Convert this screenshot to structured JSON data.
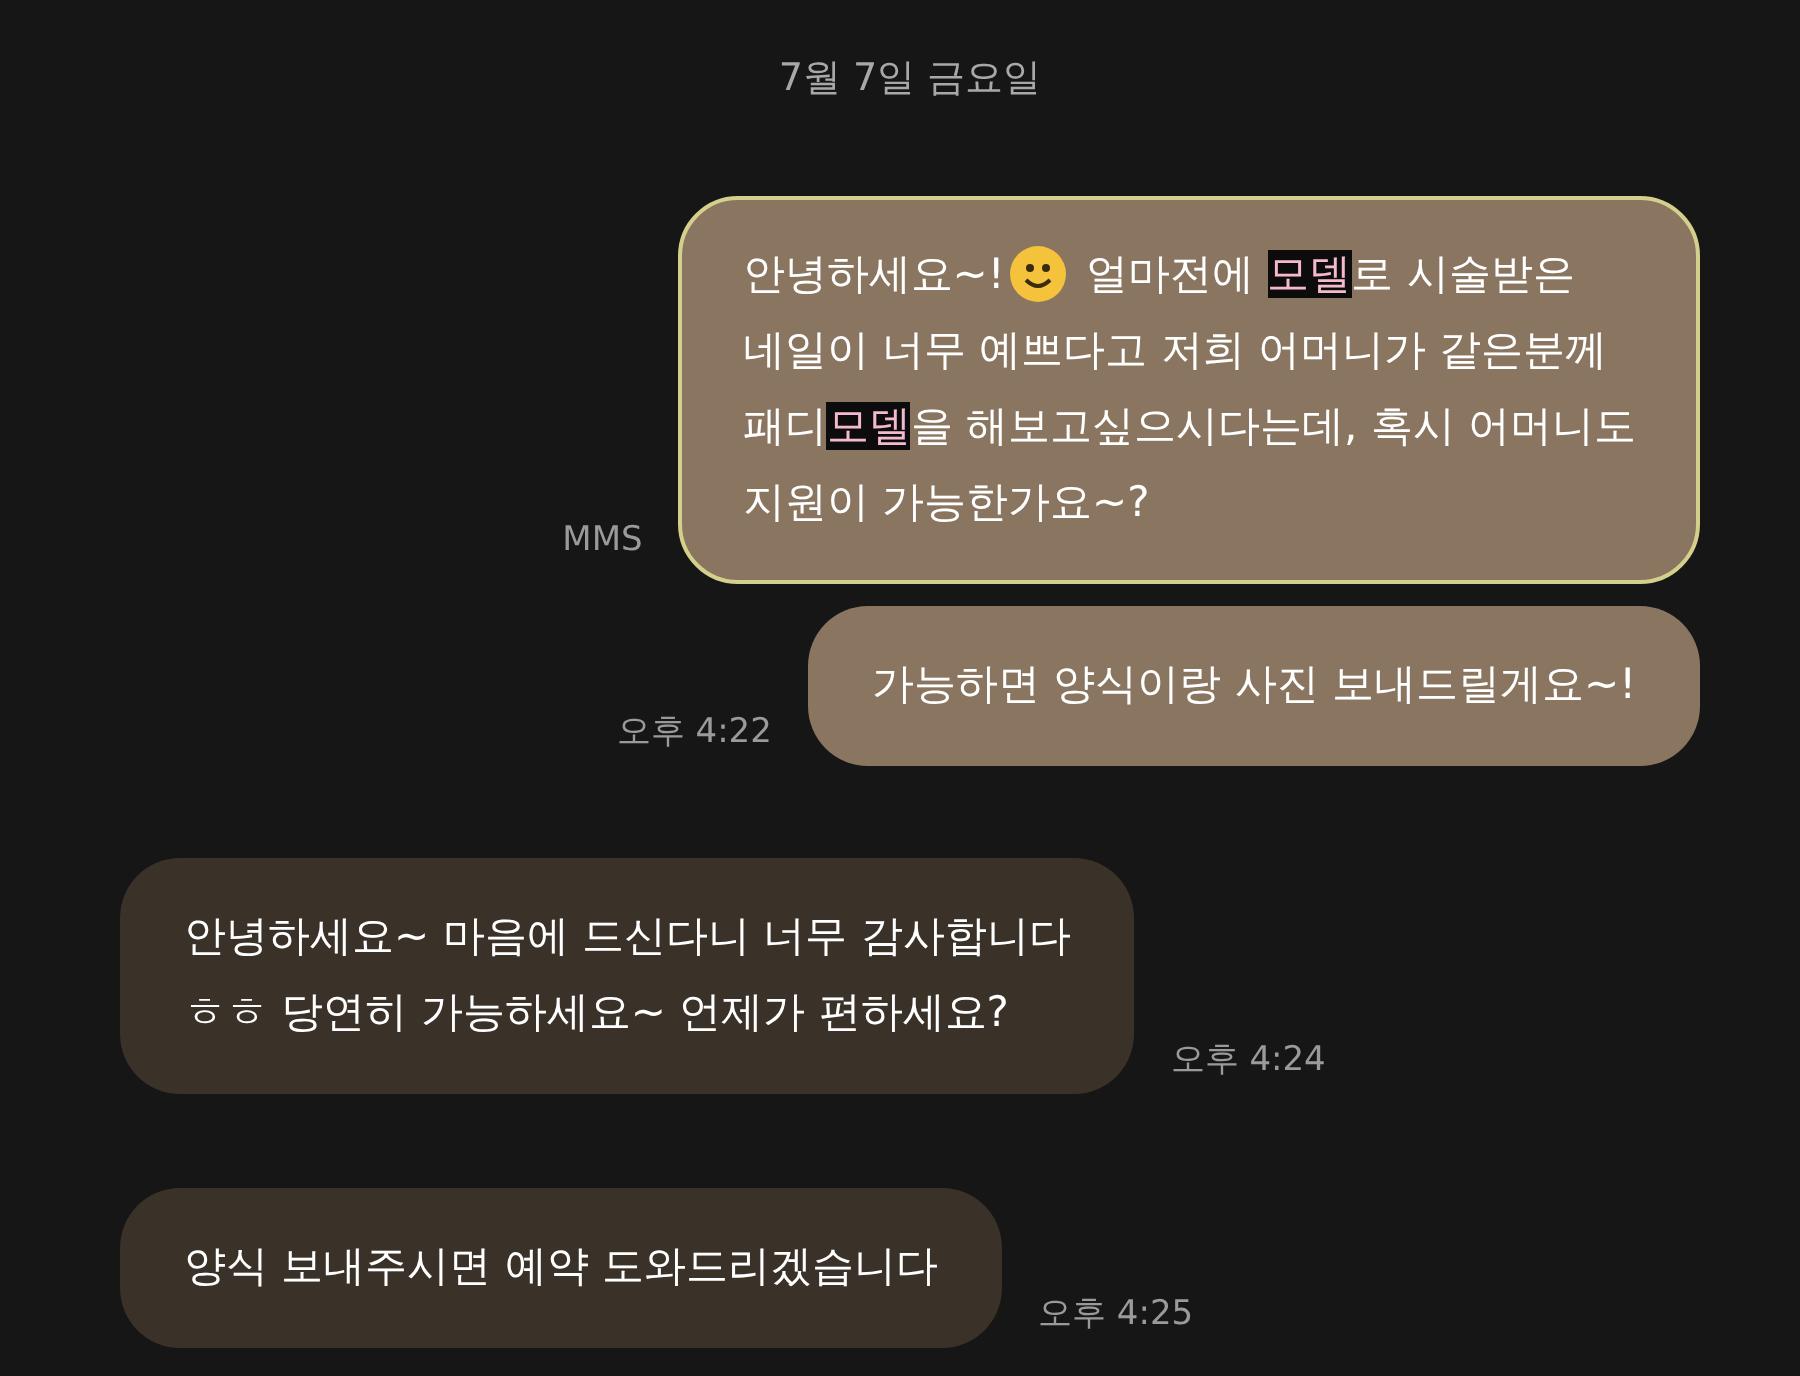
{
  "date_divider": "7월 7일 금요일",
  "messages": [
    {
      "kind": "sent",
      "selected": true,
      "label": "MMS",
      "lines": [
        [
          {
            "kind": "text",
            "text": "안녕하세요~!",
            "highlight": false
          },
          {
            "kind": "emoji"
          },
          {
            "kind": "text",
            "text": " 얼마전에 ",
            "highlight": false
          },
          {
            "kind": "text",
            "text": "모델",
            "highlight": true
          },
          {
            "kind": "text",
            "text": "로 시술받은",
            "highlight": false
          }
        ],
        [
          {
            "kind": "text",
            "text": "네일이 너무 예쁘다고 저희 어머니가 같은분께",
            "highlight": false
          }
        ],
        [
          {
            "kind": "text",
            "text": "패디",
            "highlight": false
          },
          {
            "kind": "text",
            "text": "모델",
            "highlight": true
          },
          {
            "kind": "text",
            "text": "을 해보고싶으시다는데, 혹시 어머니도",
            "highlight": false
          }
        ],
        [
          {
            "kind": "text",
            "text": "지원이 가능한가요~?",
            "highlight": false
          }
        ]
      ]
    },
    {
      "kind": "sent",
      "selected": false,
      "time": "오후 4:22",
      "lines": [
        [
          {
            "kind": "text",
            "text": "가능하면 양식이랑 사진 보내드릴게요~!",
            "highlight": false
          }
        ]
      ]
    },
    {
      "kind": "received",
      "selected": false,
      "time": "오후 4:24",
      "lines": [
        [
          {
            "kind": "text",
            "text": "안녕하세요~ 마음에 드신다니 너무 감사합니다",
            "highlight": false
          }
        ],
        [
          {
            "kind": "text",
            "text": "ㅎㅎ 당연히 가능하세요~ 언제가 편하세요?",
            "highlight": false
          }
        ]
      ]
    },
    {
      "kind": "received",
      "selected": false,
      "time": "오후 4:25",
      "lines": [
        [
          {
            "kind": "text",
            "text": "양식 보내주시면 예약 도와드리겠습니다",
            "highlight": false
          }
        ]
      ]
    }
  ]
}
